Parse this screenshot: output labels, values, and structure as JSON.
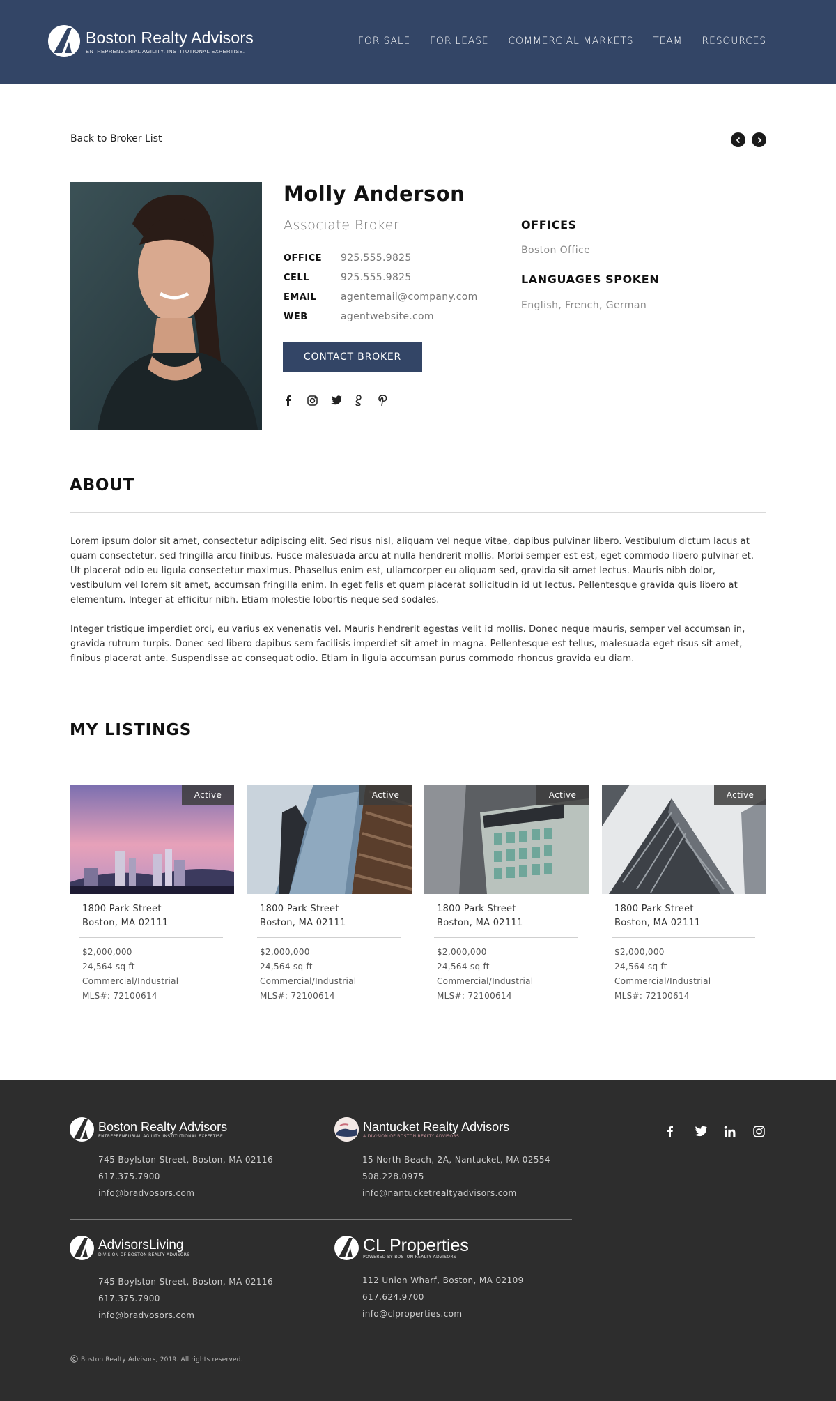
{
  "header": {
    "brand": "Boston Realty Advisors",
    "tagline": "ENTREPRENEURIAL AGILITY. INSTITUTIONAL EXPERTISE.",
    "nav": [
      "FOR SALE",
      "FOR LEASE",
      "COMMERCIAL MARKETS",
      "TEAM",
      "RESOURCES"
    ]
  },
  "back_link": "Back to Broker List",
  "profile": {
    "name": "Molly Anderson",
    "title": "Associate Broker",
    "contacts": [
      {
        "label": "OFFICE",
        "value": "925.555.9825"
      },
      {
        "label": "CELL",
        "value": "925.555.9825"
      },
      {
        "label": "EMAIL",
        "value": "agentemail@company.com"
      },
      {
        "label": "WEB",
        "value": "agentwebsite.com"
      }
    ],
    "contact_button": "CONTACT BROKER",
    "social_icons": [
      "facebook-icon",
      "instagram-icon",
      "twitter-icon",
      "google-plus-icon",
      "pinterest-icon"
    ],
    "offices_heading": "OFFICES",
    "offices_value": "Boston Office",
    "languages_heading": "LANGUAGES SPOKEN",
    "languages_value": "English,  French, German"
  },
  "about": {
    "heading": "ABOUT",
    "paragraphs": [
      "Lorem ipsum dolor sit amet, consectetur adipiscing elit. Sed risus nisl, aliquam vel neque vitae, dapibus pulvinar libero. Vestibulum dictum lacus at quam consectetur, sed fringilla arcu finibus. Fusce malesuada arcu at nulla hendrerit mollis. Morbi semper est est, eget commodo libero pulvinar et. Ut placerat odio eu ligula consectetur maximus. Phasellus enim est, ullamcorper eu aliquam sed, gravida sit amet lectus. Mauris nibh dolor, vestibulum vel lorem sit amet, accumsan fringilla enim. In eget felis et quam placerat sollicitudin id ut lectus. Pellentesque gravida quis libero at elementum. Integer at efficitur nibh. Etiam molestie lobortis neque sed sodales.",
      "Integer tristique imperdiet orci, eu varius ex venenatis vel. Mauris hendrerit egestas velit id mollis. Donec neque mauris, semper vel accumsan in, gravida rutrum turpis. Donec sed libero dapibus sem facilisis imperdiet sit amet in magna. Pellentesque est tellus, malesuada eget risus sit amet, finibus placerat ante. Suspendisse ac consequat odio. Etiam in ligula accumsan purus commodo rhoncus gravida eu diam."
    ]
  },
  "listings": {
    "heading": "MY LISTINGS",
    "items": [
      {
        "status": "Active",
        "street": "1800 Park  Street",
        "city": "Boston, MA 02111",
        "price": "$2,000,000",
        "size": "24,564 sq ft",
        "type": "Commercial/Industrial",
        "mls": "MLS#:  72100614"
      },
      {
        "status": "Active",
        "street": "1800 Park  Street",
        "city": "Boston, MA 02111",
        "price": "$2,000,000",
        "size": "24,564 sq ft",
        "type": "Commercial/Industrial",
        "mls": "MLS#:  72100614"
      },
      {
        "status": "Active",
        "street": "1800 Park  Street",
        "city": "Boston, MA 02111",
        "price": "$2,000,000",
        "size": "24,564 sq ft",
        "type": "Commercial/Industrial",
        "mls": "MLS#:  72100614"
      },
      {
        "status": "Active",
        "street": "1800 Park  Street",
        "city": "Boston, MA 02111",
        "price": "$2,000,000",
        "size": "24,564 sq ft",
        "type": "Commercial/Industrial",
        "mls": "MLS#:  72100614"
      }
    ]
  },
  "footer": {
    "brands": [
      {
        "name": "Boston Realty Advisors",
        "tag": "ENTREPRENEURIAL AGILITY. INSTITUTIONAL EXPERTISE.",
        "address": "745 Boylston Street, Boston, MA 02116",
        "phone": "617.375.7900",
        "email": "info@bradvosors.com"
      },
      {
        "name": "Nantucket Realty Advisors",
        "tag": "A DIVISION OF BOSTON REALTY ADVISORS",
        "address": "15 North Beach, 2A, Nantucket, MA 02554",
        "phone": "508.228.0975",
        "email": "info@nantucketrealtyadvisors.com"
      },
      {
        "name": "AdvisorsLiving",
        "tag": "DIVISION OF BOSTON REALTY ADVISORS",
        "address": "745 Boylston Street, Boston, MA 02116",
        "phone": "617.375.7900",
        "email": "info@bradvosors.com"
      },
      {
        "name": "CL Properties",
        "tag": "POWERED BY BOSTON REALTY ADVISORS",
        "address": "112 Union Wharf, Boston, MA 02109",
        "phone": "617.624.9700",
        "email": "info@clproperties.com"
      }
    ],
    "social_icons": [
      "facebook-icon",
      "twitter-icon",
      "linkedin-icon",
      "instagram-icon"
    ],
    "copyright": "Boston Realty Advisors, 2019.  All rights reserved."
  }
}
